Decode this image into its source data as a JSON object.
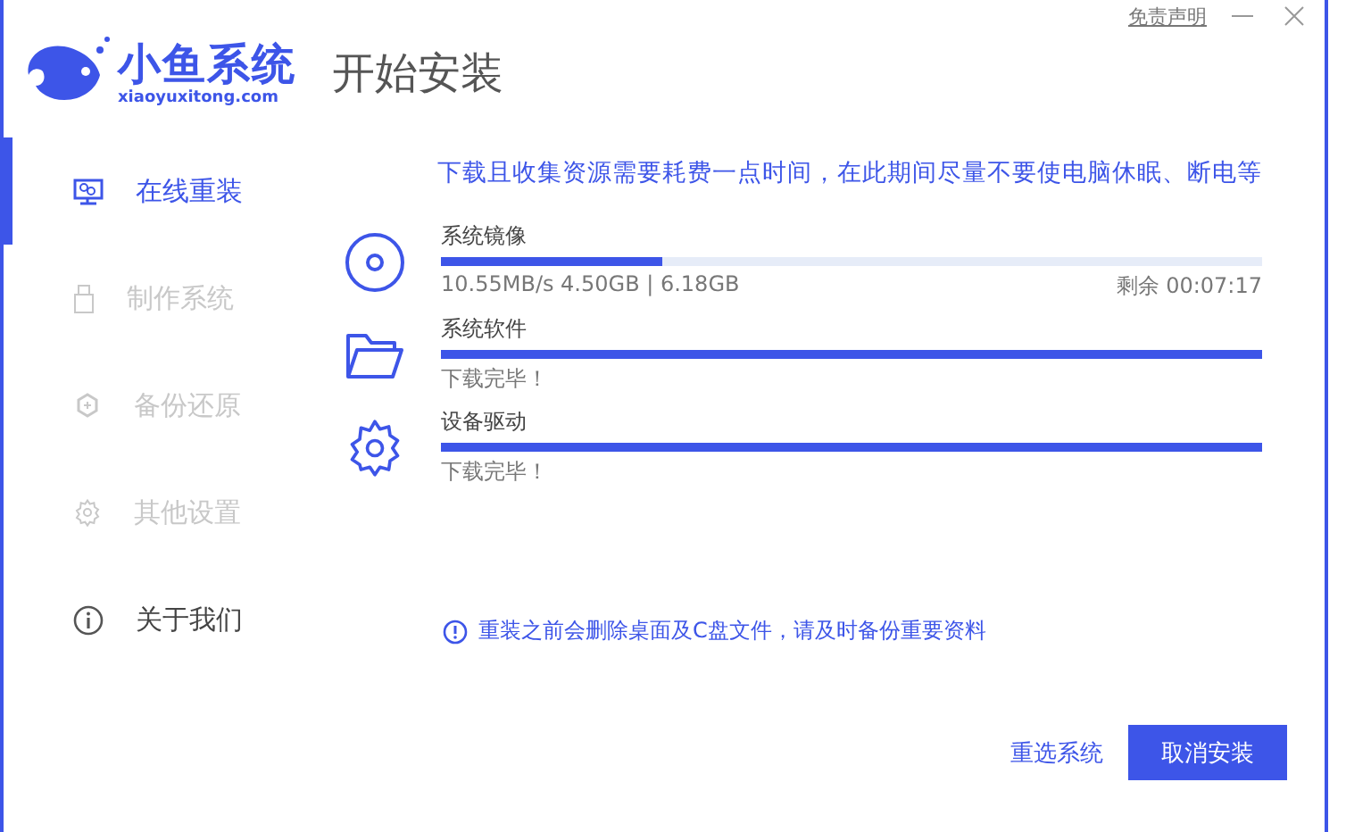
{
  "brand": {
    "name": "小鱼系统",
    "domain": "xiaoyuxitong.com"
  },
  "window": {
    "title": "开始安装",
    "disclaimer": "免责声明"
  },
  "sidebar": {
    "items": [
      {
        "label": "在线重装",
        "selected": true,
        "disabled": false
      },
      {
        "label": "制作系统",
        "selected": false,
        "disabled": true
      },
      {
        "label": "备份还原",
        "selected": false,
        "disabled": true
      },
      {
        "label": "其他设置",
        "selected": false,
        "disabled": true
      },
      {
        "label": "关于我们",
        "selected": false,
        "disabled": false
      }
    ]
  },
  "notice": "下载且收集资源需要耗费一点时间，在此期间尽量不要使电脑休眠、断电等",
  "tasks": [
    {
      "name": "系统镜像",
      "level": 0.27,
      "kind": "progress",
      "detail": "10.55MB/s 4.50GB | 6.18GB",
      "remaining": "剩余 00:07:17"
    },
    {
      "name": "系统软件",
      "level": 1,
      "kind": "done",
      "status": "下载完毕！"
    },
    {
      "name": "设备驱动",
      "level": 1,
      "kind": "done",
      "status": "下载完毕！"
    }
  ],
  "warning": "重装之前会删除桌面及C盘文件，请及时备份重要资料",
  "buttons": {
    "reselect": "重选系统",
    "cancel": "取消安装"
  }
}
